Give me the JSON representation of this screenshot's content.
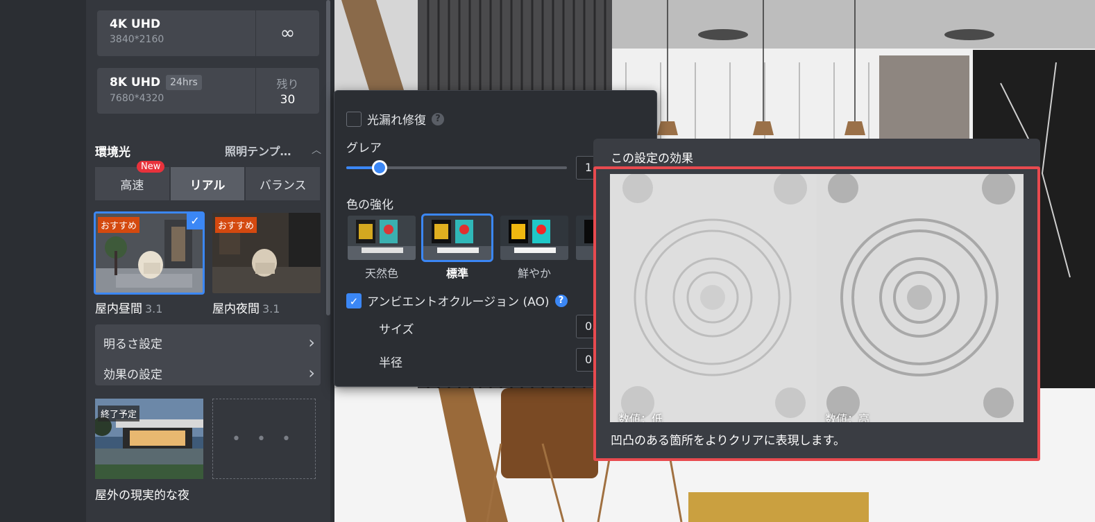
{
  "resolutions": [
    {
      "title": "4K UHD",
      "dims": "3840*2160",
      "side_icon": "infinity-icon"
    },
    {
      "title": "8K UHD",
      "badge": "24hrs",
      "dims": "7680*4320",
      "remain_label": "残り",
      "remain_value": "30"
    }
  ],
  "ambient": {
    "title": "環境光",
    "template_link": "照明テンプ…",
    "modes": [
      {
        "label": "高速",
        "badge": "New"
      },
      {
        "label": "リアル",
        "active": true
      },
      {
        "label": "バランス"
      }
    ],
    "presets": [
      {
        "label": "屋内昼間",
        "version": "3.1",
        "badge": "おすすめ",
        "selected": true
      },
      {
        "label": "屋内夜間",
        "version": "3.1",
        "badge": "おすすめ"
      }
    ],
    "settings": [
      {
        "label": "明るさ設定"
      },
      {
        "label": "効果の設定"
      }
    ],
    "extra": {
      "label": "屋外の現実的な夜",
      "badge": "終了予定",
      "more": "• • •"
    }
  },
  "popup": {
    "light_leak": {
      "label": "光漏れ修復",
      "checked": false
    },
    "glare": {
      "label": "グレア",
      "value_visible": "1"
    },
    "color_enhance": {
      "label": "色の強化",
      "options": [
        {
          "label": "天然色"
        },
        {
          "label": "標準",
          "selected": true
        },
        {
          "label": "鮮やか"
        }
      ]
    },
    "ao": {
      "label": "アンビエントオクルージョン (AO)",
      "checked": true
    },
    "size": {
      "label": "サイズ",
      "value_visible": "0."
    },
    "radius": {
      "label": "半径",
      "value_visible": "0"
    }
  },
  "effect": {
    "title": "この設定の効果",
    "low_label": "数値：低",
    "high_label": "数値：高",
    "description": "凹凸のある箇所をよりクリアに表現します。"
  },
  "colors": {
    "accent": "#3b87f5",
    "highlight_border": "#e84a4f",
    "badge_orange": "#d4490f",
    "new_red": "#e8323c"
  }
}
